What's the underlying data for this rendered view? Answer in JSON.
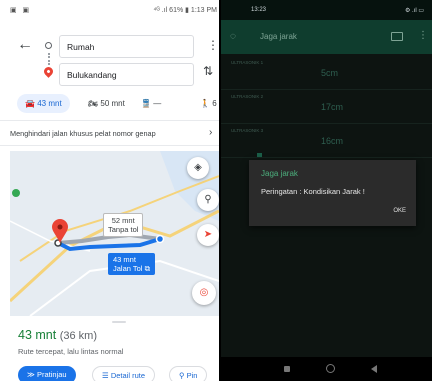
{
  "maps": {
    "status_bar": {
      "left_icons": "▣ ▣",
      "right": "⁴ᴳ .ıl 61% ▮ 1:13 PM"
    },
    "origin": "Rumah",
    "destination": "Bulukandang",
    "modes": [
      {
        "label": "43 mnt",
        "icon": "car-icon",
        "selected": true
      },
      {
        "label": "50 mnt",
        "icon": "motorbike-icon",
        "selected": false
      },
      {
        "label": "—",
        "icon": "transit-icon",
        "selected": false
      },
      {
        "label": "6",
        "icon": "walk-icon",
        "selected": false
      }
    ],
    "notice": "Menghindari jalan khusus pelat nomor genap",
    "route_alt": {
      "line1": "52 mnt",
      "line2": "Tanpa tol"
    },
    "route_main": {
      "line1": "43 mnt",
      "line2": "Jalan Tol"
    },
    "eta": "43 mnt",
    "distance": "(36 km)",
    "description": "Rute tercepat, lalu lintas normal",
    "buttons": {
      "start": "Pratinjau",
      "details": "Detail rute",
      "pin": "Pin"
    },
    "colors": {
      "accent": "#1a73e8",
      "eta": "#188038"
    }
  },
  "app": {
    "status_bar": {
      "time": "13:23",
      "right": "⚙ .ıl ▭"
    },
    "title": "Jaga jarak",
    "sensors": [
      {
        "name": "ULTRASONIK 1",
        "value": "5cm"
      },
      {
        "name": "ULTRASONIK 2",
        "value": "17cm"
      },
      {
        "name": "ULTRASONIK 3",
        "value": "16cm"
      }
    ],
    "dialog": {
      "title": "Jaga jarak",
      "message": "Peringatan : Kondisikan Jarak !",
      "ok": "OKE"
    },
    "colors": {
      "toolbar": "#0f3d2e",
      "dialog_title": "#4caf7d"
    }
  }
}
